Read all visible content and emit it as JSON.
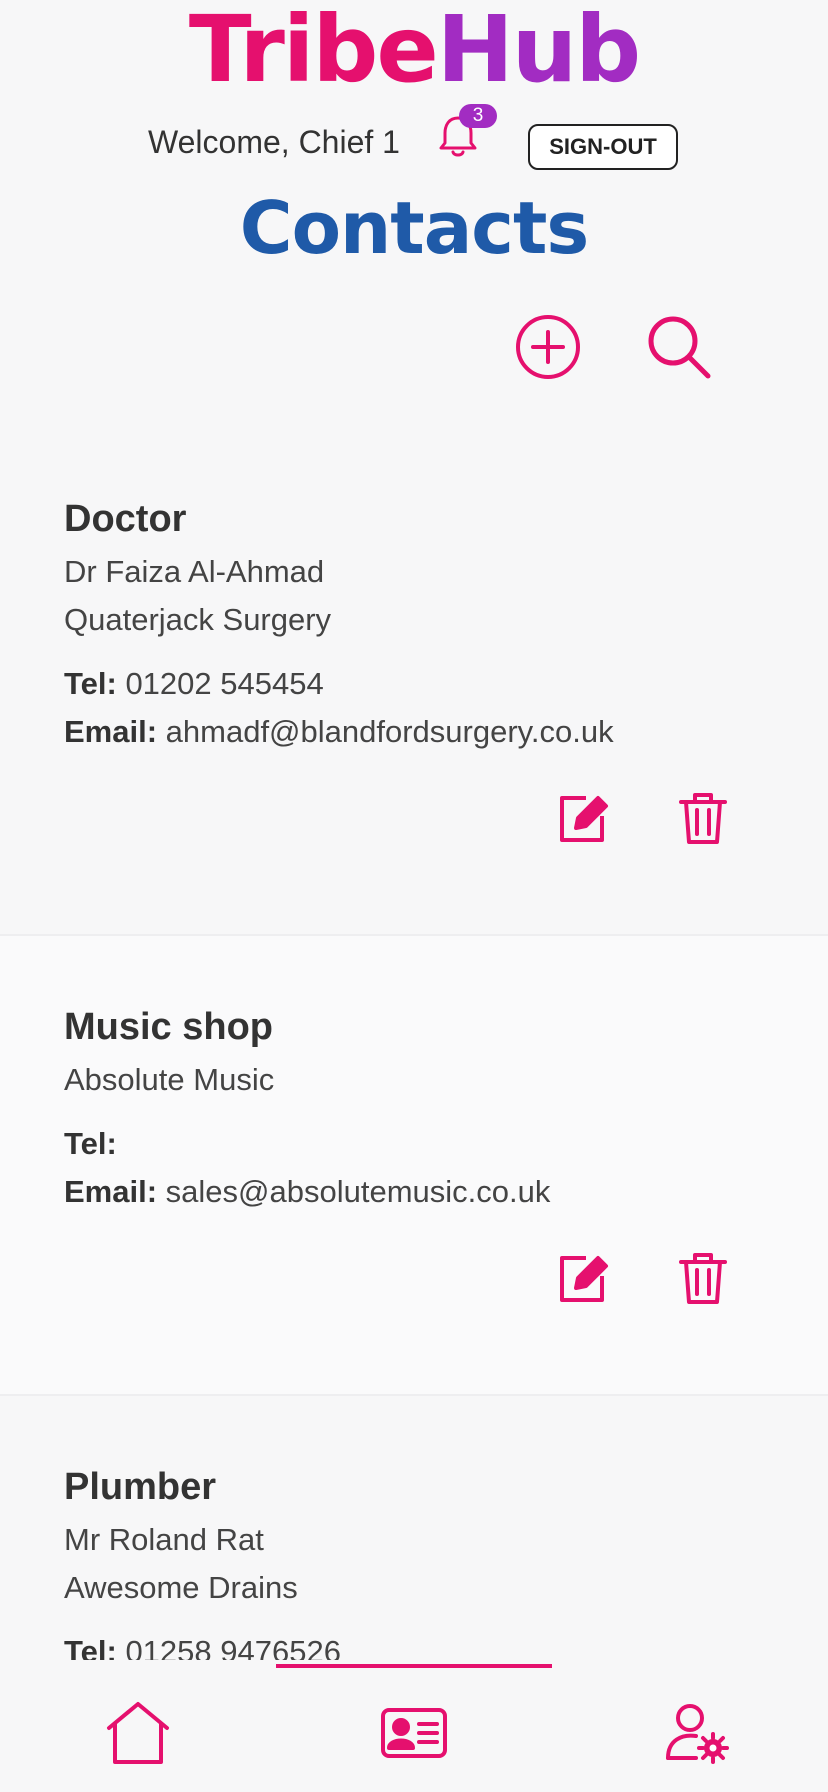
{
  "app": {
    "logo_part1": "Tribe",
    "logo_part2": "Hub",
    "brand_pink": "#e5106e",
    "brand_purple": "#a22cc2",
    "title_blue": "#1f5aa8"
  },
  "header": {
    "welcome": "Welcome, Chief 1",
    "notification_count": "3",
    "signout_label": "SIGN-OUT"
  },
  "page": {
    "title": "Contacts",
    "icons": [
      "add-circle-icon",
      "search-icon"
    ]
  },
  "contacts": [
    {
      "category": "Doctor",
      "name": "Dr Faiza Al-Ahmad",
      "organisation": "Quaterjack Surgery",
      "tel_label": "Tel:",
      "tel": "01202 545454",
      "email_label": "Email:",
      "email": "ahmadf@blandfordsurgery.co.uk"
    },
    {
      "category": "Music shop",
      "organisation": "Absolute Music",
      "tel_label": "Tel:",
      "tel": "",
      "email_label": "Email:",
      "email": "sales@absolutemusic.co.uk"
    },
    {
      "category": "Plumber",
      "name": "Mr Roland Rat",
      "organisation": "Awesome Drains",
      "tel_label": "Tel:",
      "tel": "01258 9476526"
    }
  ],
  "nav": {
    "items": [
      "home-icon",
      "contacts-card-icon",
      "user-settings-icon"
    ],
    "active": "contacts-card-icon"
  }
}
